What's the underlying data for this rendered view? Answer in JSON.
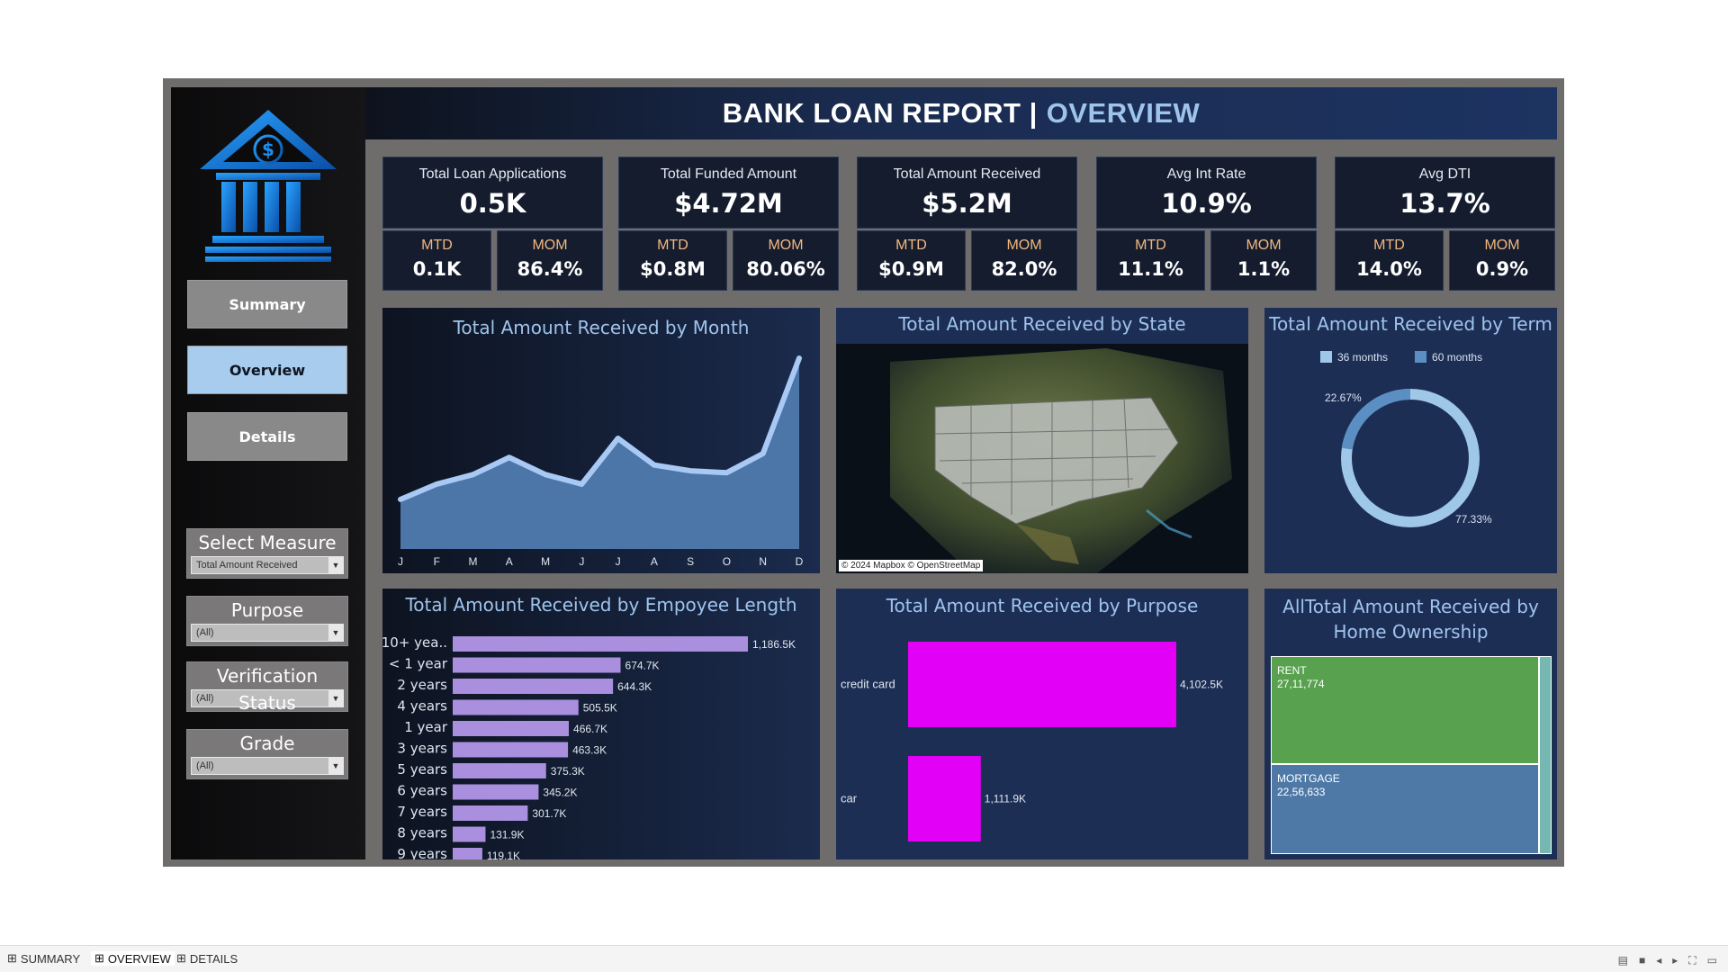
{
  "header": {
    "title_main": "BANK LOAN REPORT |",
    "title_accent": "OVERVIEW"
  },
  "nav": {
    "summary": "Summary",
    "overview": "Overview",
    "details": "Details"
  },
  "filters": [
    {
      "label": "Select Measure",
      "value": "Total Amount Received"
    },
    {
      "label": "Purpose",
      "value": "(All)"
    },
    {
      "label": "Verification Status",
      "value": "(All)"
    },
    {
      "label": "Grade",
      "value": "(All)"
    }
  ],
  "kpis": [
    {
      "title": "Total Loan Applications",
      "value": "0.5K",
      "mtd_label": "MTD",
      "mtd": "0.1K",
      "mom_label": "MOM",
      "mom": "86.4%"
    },
    {
      "title": "Total Funded Amount",
      "value": "$4.72M",
      "mtd_label": "MTD",
      "mtd": "$0.8M",
      "mom_label": "MOM",
      "mom": "80.06%"
    },
    {
      "title": "Total Amount Received",
      "value": "$5.2M",
      "mtd_label": "MTD",
      "mtd": "$0.9M",
      "mom_label": "MOM",
      "mom": "82.0%"
    },
    {
      "title": "Avg Int Rate",
      "value": "10.9%",
      "mtd_label": "MTD",
      "mtd": "11.1%",
      "mom_label": "MOM",
      "mom": "1.1%"
    },
    {
      "title": "Avg DTI",
      "value": "13.7%",
      "mtd_label": "MTD",
      "mtd": "14.0%",
      "mom_label": "MOM",
      "mom": "0.9%"
    }
  ],
  "panels": {
    "month": "Total Amount Received by Month",
    "state": "Total Amount Received by State",
    "state_attribution": "© 2024 Mapbox © OpenStreetMap",
    "term": "Total Amount Received by Term",
    "emp": "Total Amount Received by Empoyee Length",
    "purpose": "Total Amount Received by Purpose",
    "home_line1": "AllTotal Amount Received by",
    "home_line2": "Home Ownership"
  },
  "colors": {
    "area": "#4d76a8",
    "area_line": "#a9c9f5",
    "emp_bar": "#a98fde",
    "purpose_bar": "#e200f7",
    "rent": "#58a14e",
    "mortgage": "#4e79a7",
    "donut_36": "#9fc7e8",
    "donut_60": "#5b8fc4"
  },
  "chart_data": [
    {
      "type": "area",
      "title": "Total Amount Received by Month",
      "categories": [
        "J",
        "F",
        "M",
        "A",
        "M",
        "J",
        "J",
        "A",
        "S",
        "O",
        "N",
        "D"
      ],
      "values": [
        0.26,
        0.34,
        0.39,
        0.48,
        0.39,
        0.34,
        0.58,
        0.44,
        0.41,
        0.4,
        0.5,
        1.0
      ]
    },
    {
      "type": "pie",
      "title": "Total Amount Received by Term",
      "legend": [
        "36 months",
        "60 months"
      ],
      "labels": [
        "22.67%",
        "77.33%"
      ],
      "values": [
        22.67,
        77.33
      ]
    },
    {
      "type": "bar",
      "title": "Total Amount Received by Empoyee Length",
      "categories": [
        "10+ yea..",
        "< 1 year",
        "2 years",
        "4 years",
        "1 year",
        "3 years",
        "5 years",
        "6 years",
        "7 years",
        "8 years",
        "9 years"
      ],
      "values": [
        1186.5,
        674.7,
        644.3,
        505.5,
        466.7,
        463.3,
        375.3,
        345.2,
        301.7,
        131.9,
        119.1
      ],
      "labels": [
        "1,186.5K",
        "674.7K",
        "644.3K",
        "505.5K",
        "466.7K",
        "463.3K",
        "375.3K",
        "345.2K",
        "301.7K",
        "131.9K",
        "119.1K"
      ]
    },
    {
      "type": "bar",
      "title": "Total Amount Received by Purpose",
      "categories": [
        "credit card",
        "car"
      ],
      "values": [
        4102.5,
        1111.9
      ],
      "labels": [
        "4,102.5K",
        "1,111.9K"
      ]
    },
    {
      "type": "heatmap",
      "title": "AllTotal Amount Received by Home Ownership",
      "categories": [
        "RENT",
        "MORTGAGE"
      ],
      "values": [
        2711774,
        2256633
      ],
      "labels": [
        "27,11,774",
        "22,56,633"
      ]
    }
  ],
  "tabs": [
    "SUMMARY",
    "OVERVIEW",
    "DETAILS"
  ]
}
